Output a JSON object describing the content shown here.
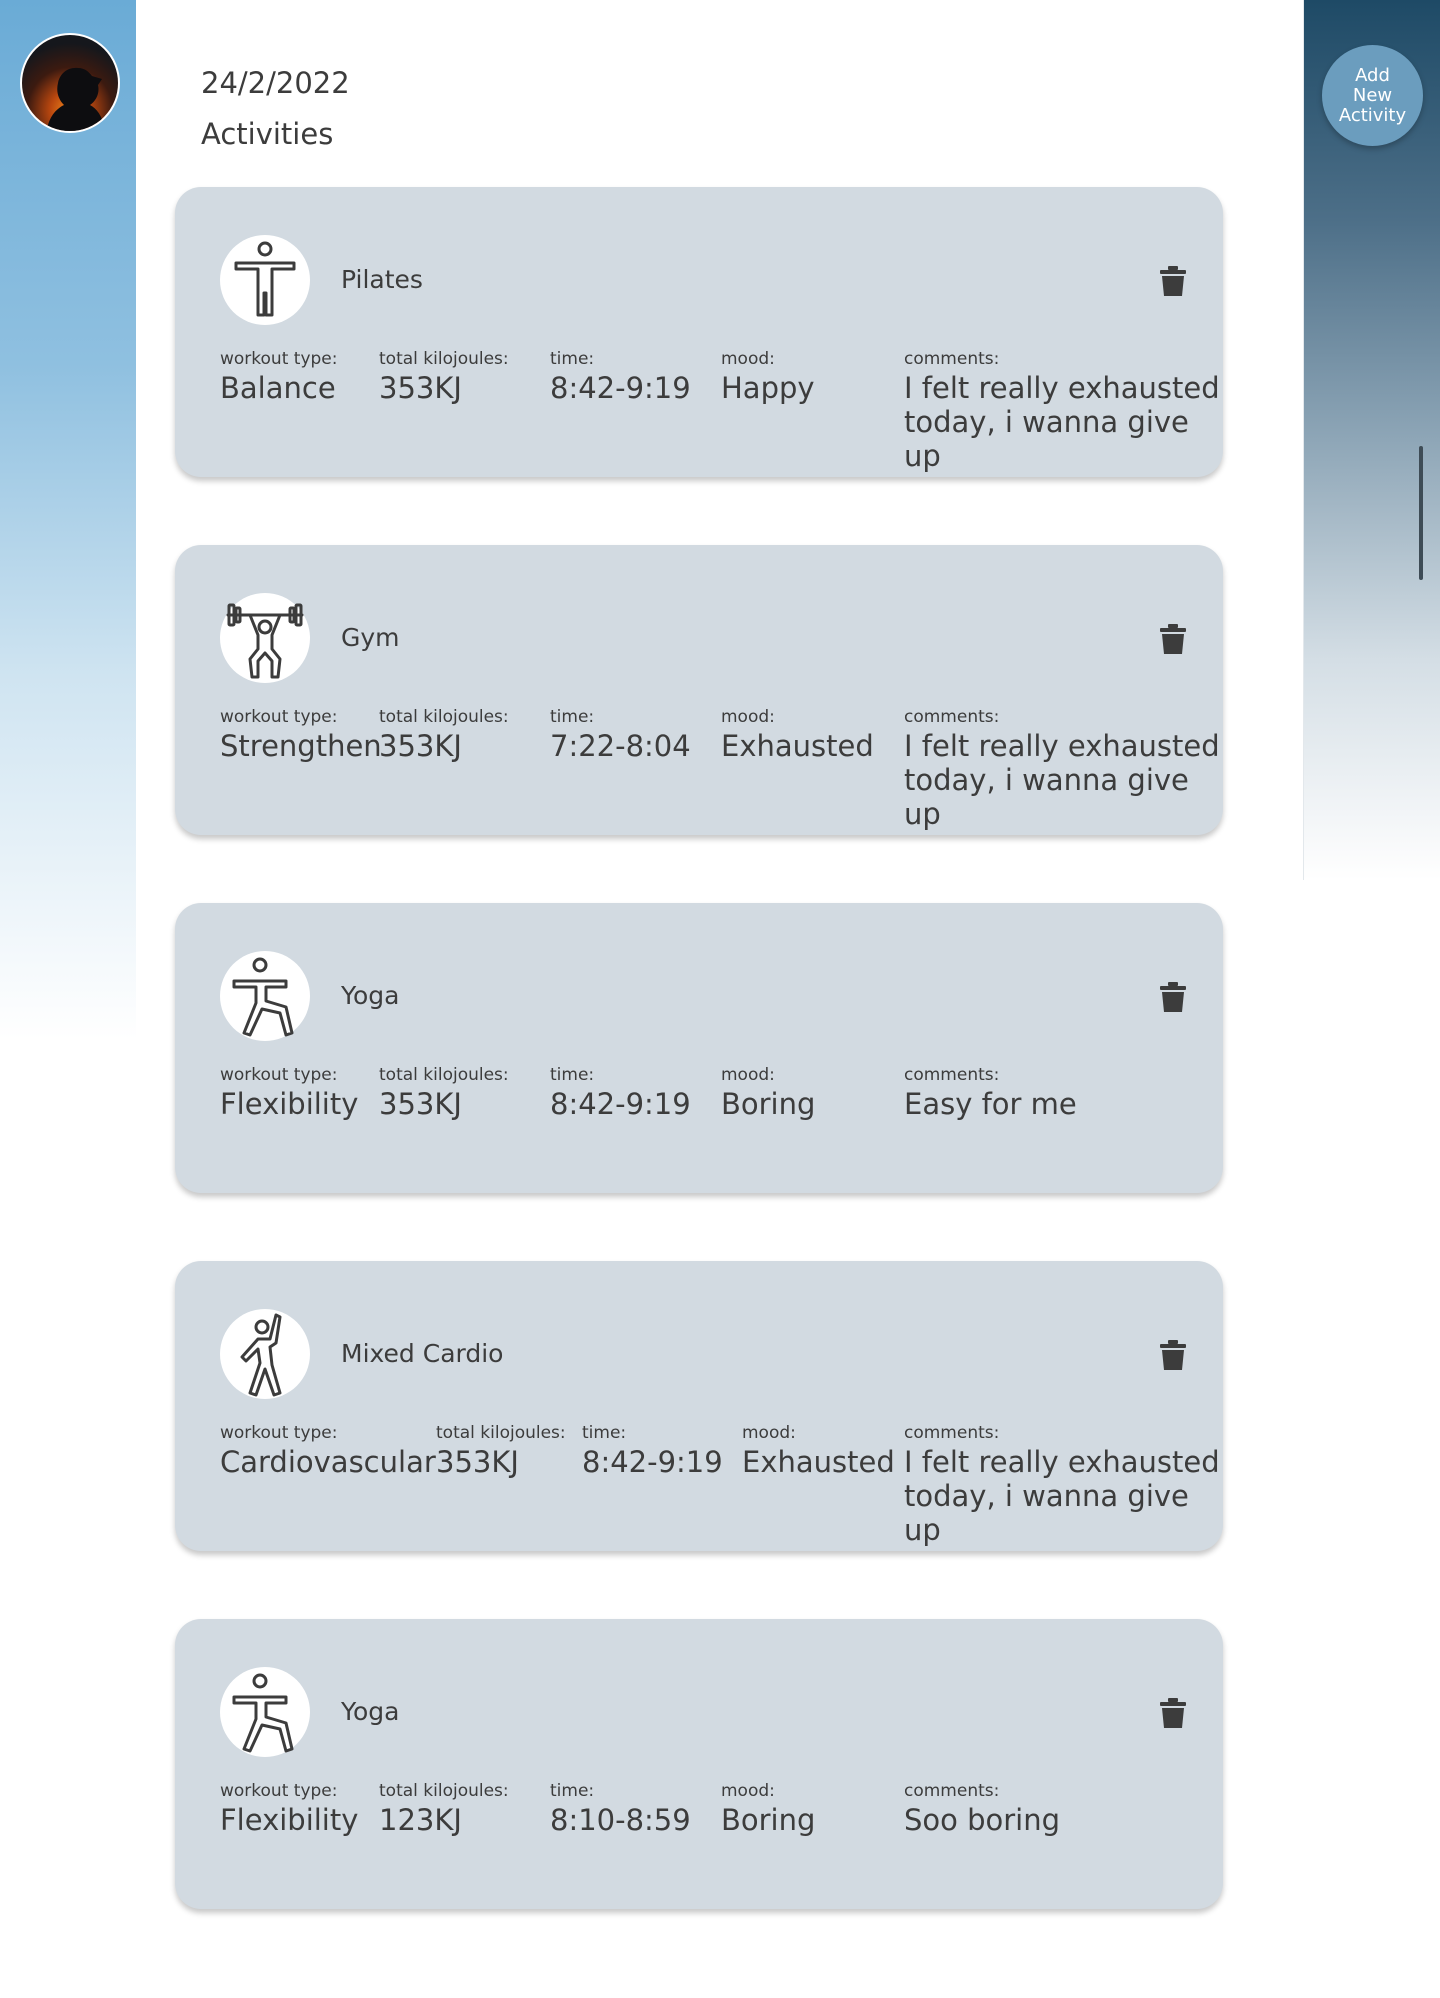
{
  "header": {
    "date": "24/2/2022",
    "title": "Activities"
  },
  "actions": {
    "add_label": "Add\nNew\nActivity"
  },
  "labels": {
    "workout_type": "workout type:",
    "kilojoules": "total kilojoules:",
    "time": "time:",
    "mood": "mood:",
    "comments": "comments:"
  },
  "activities": [
    {
      "name": "Pilates",
      "icon": "pilates-figure-icon",
      "workout_type": "Balance",
      "kilojoules": "353KJ",
      "time": "8:42-9:19",
      "mood": "Happy",
      "comments": "I felt really exhausted today, i wanna give up"
    },
    {
      "name": "Gym",
      "icon": "weightlifting-figure-icon",
      "workout_type": "Strengthen",
      "kilojoules": "353KJ",
      "time": "7:22-8:04",
      "mood": "Exhausted",
      "comments": "I felt really exhausted today, i wanna give up"
    },
    {
      "name": "Yoga",
      "icon": "yoga-figure-icon",
      "workout_type": "Flexibility",
      "kilojoules": "353KJ",
      "time": "8:42-9:19",
      "mood": "Boring",
      "comments": "Easy for me"
    },
    {
      "name": "Mixed Cardio",
      "icon": "cardio-figure-icon",
      "workout_type": "Cardiovascular",
      "kilojoules": "353KJ",
      "time": "8:42-9:19",
      "mood": "Exhausted",
      "comments": "I felt really exhausted today, i wanna give up"
    },
    {
      "name": "Yoga",
      "icon": "yoga-figure-icon",
      "workout_type": "Flexibility",
      "kilojoules": "123KJ",
      "time": "8:10-8:59",
      "mood": "Boring",
      "comments": "Soo boring"
    }
  ],
  "colors": {
    "card_bg": "#d2dae1",
    "add_button": "#6b9dbe",
    "text": "#3c3c3c"
  }
}
